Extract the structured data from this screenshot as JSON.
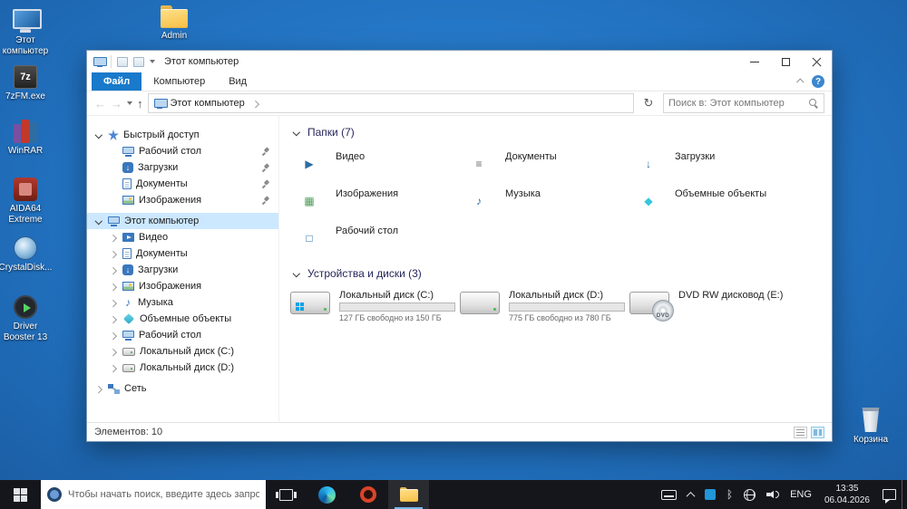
{
  "desktop": {
    "icons": [
      {
        "label": "Этот компьютер"
      },
      {
        "label": "Admin"
      },
      {
        "label": "7zFM.exe"
      },
      {
        "label": "WinRAR"
      },
      {
        "label": "AIDA64 Extreme"
      },
      {
        "label": "CrystalDisk..."
      },
      {
        "label": "Driver Booster 13"
      },
      {
        "label": "Корзина"
      }
    ],
    "app_glyphs": {
      "sevenzip": "7z"
    }
  },
  "explorer": {
    "title": "Этот компьютер",
    "ribbon": {
      "tabs": [
        "Файл",
        "Компьютер",
        "Вид"
      ]
    },
    "address": {
      "location": "Этот компьютер",
      "search_placeholder": "Поиск в: Этот компьютер"
    },
    "sidebar": {
      "items": [
        "Быстрый доступ",
        "Рабочий стол",
        "Загрузки",
        "Документы",
        "Изображения",
        "Этот компьютер",
        "Видео",
        "Документы",
        "Загрузки",
        "Изображения",
        "Музыка",
        "Объемные объекты",
        "Рабочий стол",
        "Локальный диск (C:)",
        "Локальный диск (D:)",
        "Сеть"
      ]
    },
    "content": {
      "folders_header": "Папки (7)",
      "folders": [
        "Видео",
        "Документы",
        "Загрузки",
        "Изображения",
        "Музыка",
        "Объемные объекты",
        "Рабочий стол"
      ],
      "devices_header": "Устройства и диски (3)",
      "drives": [
        {
          "name": "Локальный диск (C:)",
          "free_text": "127 ГБ свободно из 150 ГБ",
          "used_percent": 15
        },
        {
          "name": "Локальный диск (D:)",
          "free_text": "775 ГБ свободно из 780 ГБ",
          "used_percent": 1
        },
        {
          "name": "DVD RW дисковод (E:)",
          "disc_label": "DVD"
        }
      ]
    },
    "status": "Элементов: 10"
  },
  "taskbar": {
    "search_placeholder": "Чтобы начать поиск, введите здесь запрос",
    "language": "ENG",
    "time": "13:35",
    "date": "06.04.2026"
  }
}
